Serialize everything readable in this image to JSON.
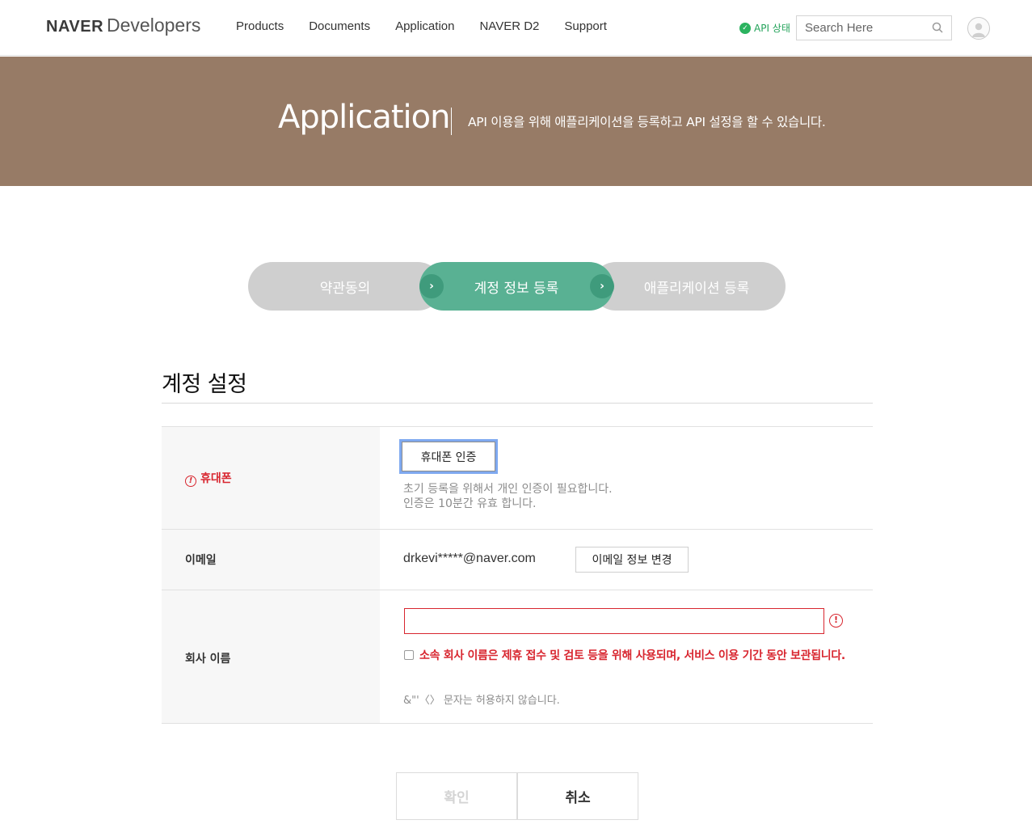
{
  "header": {
    "logo_brand": "NAVER",
    "logo_product": "Developers",
    "nav": [
      "Products",
      "Documents",
      "Application",
      "NAVER D2",
      "Support"
    ],
    "api_status_label": "API 상태",
    "search_placeholder": "Search Here"
  },
  "banner": {
    "title": "Application",
    "description": "API 이용을 위해 애플리케이션을 등록하고 API 설정을 할 수 있습니다."
  },
  "steps": [
    {
      "label": "약관동의",
      "state": "done"
    },
    {
      "label": "계정 정보 등록",
      "state": "active"
    },
    {
      "label": "애플리케이션 등록",
      "state": "pending"
    }
  ],
  "section": {
    "title": "계정 설정"
  },
  "form": {
    "phone": {
      "label": "휴대폰",
      "button": "휴대폰 인증",
      "hint_line1": "초기 등록을 위해서 개인 인증이 필요합니다.",
      "hint_line2": "인증은 10분간 유효 합니다."
    },
    "email": {
      "label": "이메일",
      "value": "drkevi*****@naver.com",
      "button": "이메일 정보 변경"
    },
    "company": {
      "label": "회사 이름",
      "value": "",
      "agree_text": "소속 회사 이름은 제휴 접수 및 검토 등을 위해 사용되며, 서비스 이용 기간 동안 보관됩니다.",
      "hint": "&\"'〈〉 문자는 허용하지 않습니다."
    }
  },
  "actions": {
    "confirm": "확인",
    "cancel": "취소"
  },
  "colors": {
    "banner": "#977b66",
    "step_active": "#59b193",
    "step_inactive": "#cfcfcf",
    "error": "#d8262f",
    "status_ok": "#2bb35f"
  }
}
